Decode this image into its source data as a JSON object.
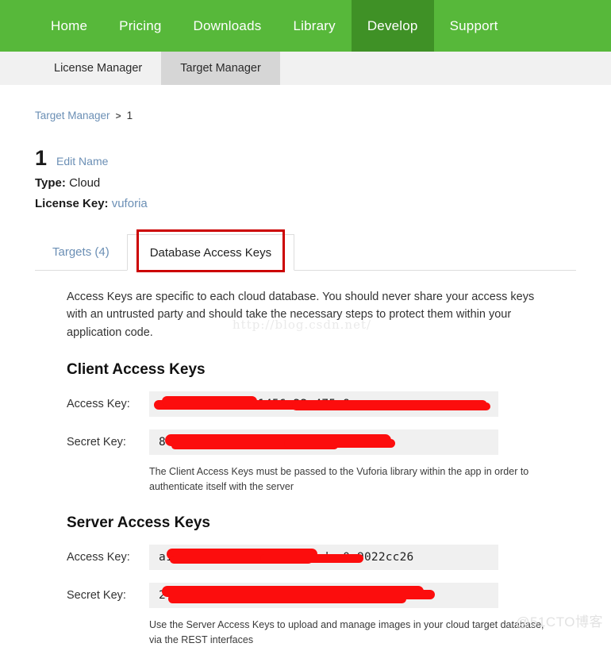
{
  "topnav": {
    "items": [
      {
        "label": "Home",
        "active": false
      },
      {
        "label": "Pricing",
        "active": false
      },
      {
        "label": "Downloads",
        "active": false
      },
      {
        "label": "Library",
        "active": false
      },
      {
        "label": "Develop",
        "active": true
      },
      {
        "label": "Support",
        "active": false
      }
    ],
    "bg_color": "#57b83a",
    "active_color": "#3f9126"
  },
  "subnav": {
    "items": [
      {
        "label": "License Manager",
        "active": false
      },
      {
        "label": "Target Manager",
        "active": true
      }
    ]
  },
  "breadcrumb": {
    "root": "Target Manager",
    "separator": ">",
    "current": "1"
  },
  "database": {
    "name": "1",
    "edit_name_label": "Edit Name",
    "type_label": "Type:",
    "type_value": "Cloud",
    "license_key_label": "License Key:",
    "license_key_value": "vuforia"
  },
  "tabs": {
    "items": [
      {
        "label": "Targets (4)",
        "active": false
      },
      {
        "label": "Database Access Keys",
        "active": true
      }
    ],
    "highlight_color": "#cc0000"
  },
  "content": {
    "intro": "Access Keys are specific to each cloud database. You should never share your access keys with an untrusted party and should take the necessary steps to protect them within your application code.",
    "client_section": {
      "heading": "Client Access Keys",
      "access_key_label": "Access Key:",
      "access_key_value": "a                      d1a15    4976891456 22 475      8",
      "secret_key_label": "Secret Key:",
      "secret_key_value": "8c                 ---                  b83cbacec40b134e",
      "note": "The Client Access Keys must be passed to the Vuforia library within the app in order to authenticate itself with the server"
    },
    "server_section": {
      "heading": "Server Access Keys",
      "access_key_label": "Access Key:",
      "access_key_value": "a1f                 -----        ------  8ca39edea0c9022cc26",
      "secret_key_label": "Secret Key:",
      "secret_key_value": "2f                                          9207ca0c0",
      "note": "Use the Server Access Keys to upload and manage images in your cloud target database, via the REST interfaces"
    }
  },
  "watermarks": {
    "csdn": "http://blog.csdn.net/",
    "cto": "@51CTO博客"
  }
}
